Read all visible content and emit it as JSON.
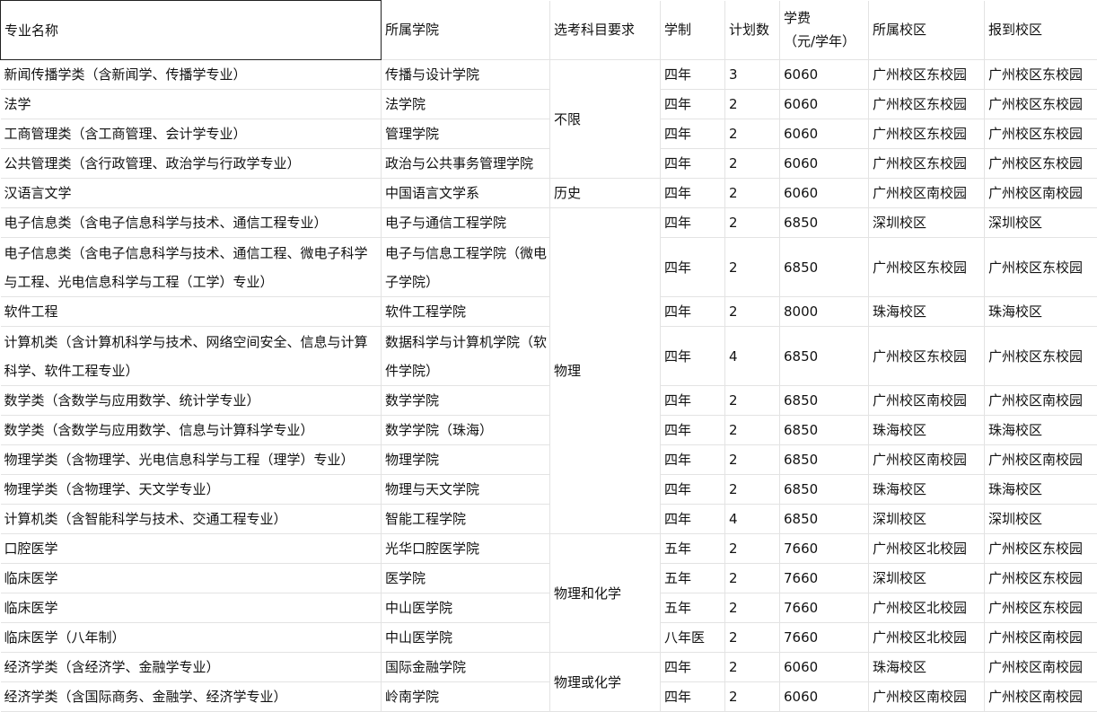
{
  "headers": {
    "major": "专业名称",
    "college": "所属学院",
    "subject": "选考科目要求",
    "years": "学制",
    "quota": "计划数",
    "fee_line1": "学费",
    "fee_line2": "（元/学年）",
    "campus": "所属校区",
    "report": "报到校区"
  },
  "subject_groups": [
    "不限",
    "历史",
    "物理",
    "物理和化学",
    "物理或化学"
  ],
  "rows": [
    {
      "major": "新闻传播学类（含新闻学、传播学专业）",
      "college": "传播与设计学院",
      "years": "四年",
      "quota": "3",
      "fee": "6060",
      "campus": "广州校区东校园",
      "report": "广州校区东校园"
    },
    {
      "major": "法学",
      "college": "法学院",
      "years": "四年",
      "quota": "2",
      "fee": "6060",
      "campus": "广州校区东校园",
      "report": "广州校区东校园"
    },
    {
      "major": "工商管理类（含工商管理、会计学专业）",
      "college": "管理学院",
      "years": "四年",
      "quota": "2",
      "fee": "6060",
      "campus": "广州校区东校园",
      "report": "广州校区东校园"
    },
    {
      "major": "公共管理类（含行政管理、政治学与行政学专业）",
      "college": "政治与公共事务管理学院",
      "years": "四年",
      "quota": "2",
      "fee": "6060",
      "campus": "广州校区东校园",
      "report": "广州校区东校园"
    },
    {
      "major": "汉语言文学",
      "college": "中国语言文学系",
      "years": "四年",
      "quota": "2",
      "fee": "6060",
      "campus": "广州校区南校园",
      "report": "广州校区南校园"
    },
    {
      "major": "电子信息类（含电子信息科学与技术、通信工程专业）",
      "college": "电子与通信工程学院",
      "years": "四年",
      "quota": "2",
      "fee": "6850",
      "campus": "深圳校区",
      "report": "深圳校区"
    },
    {
      "major": "电子信息类（含电子信息科学与技术、通信工程、微电子科学与工程、光电信息科学与工程（工学）专业）",
      "college": "电子与信息工程学院（微电子学院）",
      "years": "四年",
      "quota": "2",
      "fee": "6850",
      "campus": "广州校区东校园",
      "report": "广州校区东校园"
    },
    {
      "major": "软件工程",
      "college": "软件工程学院",
      "years": "四年",
      "quota": "2",
      "fee": "8000",
      "campus": "珠海校区",
      "report": "珠海校区"
    },
    {
      "major": "计算机类（含计算机科学与技术、网络空间安全、信息与计算科学、软件工程专业）",
      "college": "数据科学与计算机学院（软件学院）",
      "years": "四年",
      "quota": "4",
      "fee": "6850",
      "campus": "广州校区东校园",
      "report": "广州校区东校园"
    },
    {
      "major": "数学类（含数学与应用数学、统计学专业）",
      "college": "数学学院",
      "years": "四年",
      "quota": "2",
      "fee": "6850",
      "campus": "广州校区南校园",
      "report": "广州校区南校园"
    },
    {
      "major": "数学类（含数学与应用数学、信息与计算科学专业）",
      "college": "数学学院（珠海）",
      "years": "四年",
      "quota": "2",
      "fee": "6850",
      "campus": "珠海校区",
      "report": "珠海校区"
    },
    {
      "major": "物理学类（含物理学、光电信息科学与工程（理学）专业）",
      "college": "物理学院",
      "years": "四年",
      "quota": "2",
      "fee": "6850",
      "campus": "广州校区南校园",
      "report": "广州校区南校园"
    },
    {
      "major": "物理学类（含物理学、天文学专业）",
      "college": "物理与天文学院",
      "years": "四年",
      "quota": "2",
      "fee": "6850",
      "campus": "珠海校区",
      "report": "珠海校区"
    },
    {
      "major": "计算机类（含智能科学与技术、交通工程专业）",
      "college": "智能工程学院",
      "years": "四年",
      "quota": "4",
      "fee": "6850",
      "campus": "深圳校区",
      "report": "深圳校区"
    },
    {
      "major": "口腔医学",
      "college": "光华口腔医学院",
      "years": "五年",
      "quota": "2",
      "fee": "7660",
      "campus": "广州校区北校园",
      "report": "广州校区东校园"
    },
    {
      "major": "临床医学",
      "college": "医学院",
      "years": "五年",
      "quota": "2",
      "fee": "7660",
      "campus": "深圳校区",
      "report": "广州校区东校园"
    },
    {
      "major": "临床医学",
      "college": "中山医学院",
      "years": "五年",
      "quota": "2",
      "fee": "7660",
      "campus": "广州校区北校园",
      "report": "广州校区东校园"
    },
    {
      "major": "临床医学（八年制）",
      "college": "中山医学院",
      "years": "八年医",
      "quota": "2",
      "fee": "7660",
      "campus": "广州校区北校园",
      "report": "广州校区南校园"
    },
    {
      "major": "经济学类（含经济学、金融学专业）",
      "college": "国际金融学院",
      "years": "四年",
      "quota": "2",
      "fee": "6060",
      "campus": "珠海校区",
      "report": "广州校区南校园"
    },
    {
      "major": "经济学类（含国际商务、金融学、经济学专业）",
      "college": "岭南学院",
      "years": "四年",
      "quota": "2",
      "fee": "6060",
      "campus": "广州校区南校园",
      "report": "广州校区南校园"
    }
  ]
}
